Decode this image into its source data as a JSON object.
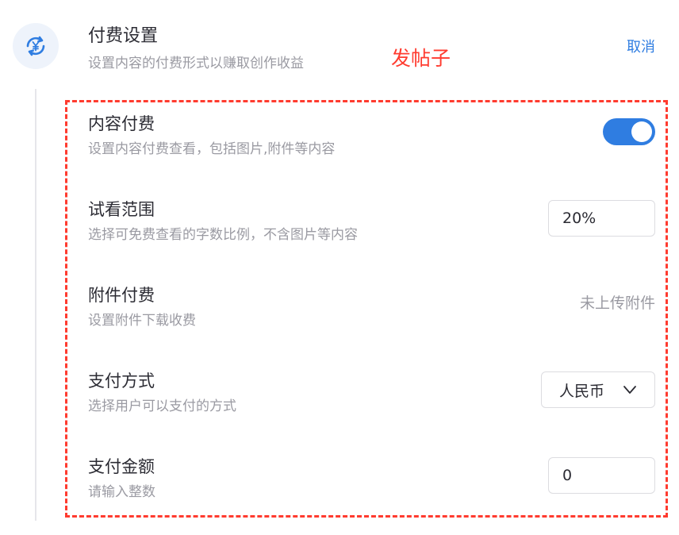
{
  "header": {
    "icon": "yuan-refresh-icon",
    "title": "付费设置",
    "subtitle": "设置内容的付费形式以赚取创作收益",
    "annotation": "发帖子",
    "cancel_label": "取消"
  },
  "colors": {
    "accent": "#2f7de1",
    "annotation": "#ff3b2f",
    "muted_text": "#9a9aa2"
  },
  "settings": [
    {
      "title": "内容付费",
      "description": "设置内容付费查看，包括图片,附件等内容",
      "control": "toggle",
      "enabled": true
    },
    {
      "title": "试看范围",
      "description": "选择可免费查看的字数比例，不含图片等内容",
      "control": "input",
      "value": "20%"
    },
    {
      "title": "附件付费",
      "description": "设置附件下载收费",
      "control": "text",
      "value": "未上传附件"
    },
    {
      "title": "支付方式",
      "description": "选择用户可以支付的方式",
      "control": "select",
      "value": "人民币",
      "icon": "chevron-down-icon"
    },
    {
      "title": "支付金额",
      "description": "请输入整数",
      "control": "input",
      "value": "0"
    }
  ]
}
